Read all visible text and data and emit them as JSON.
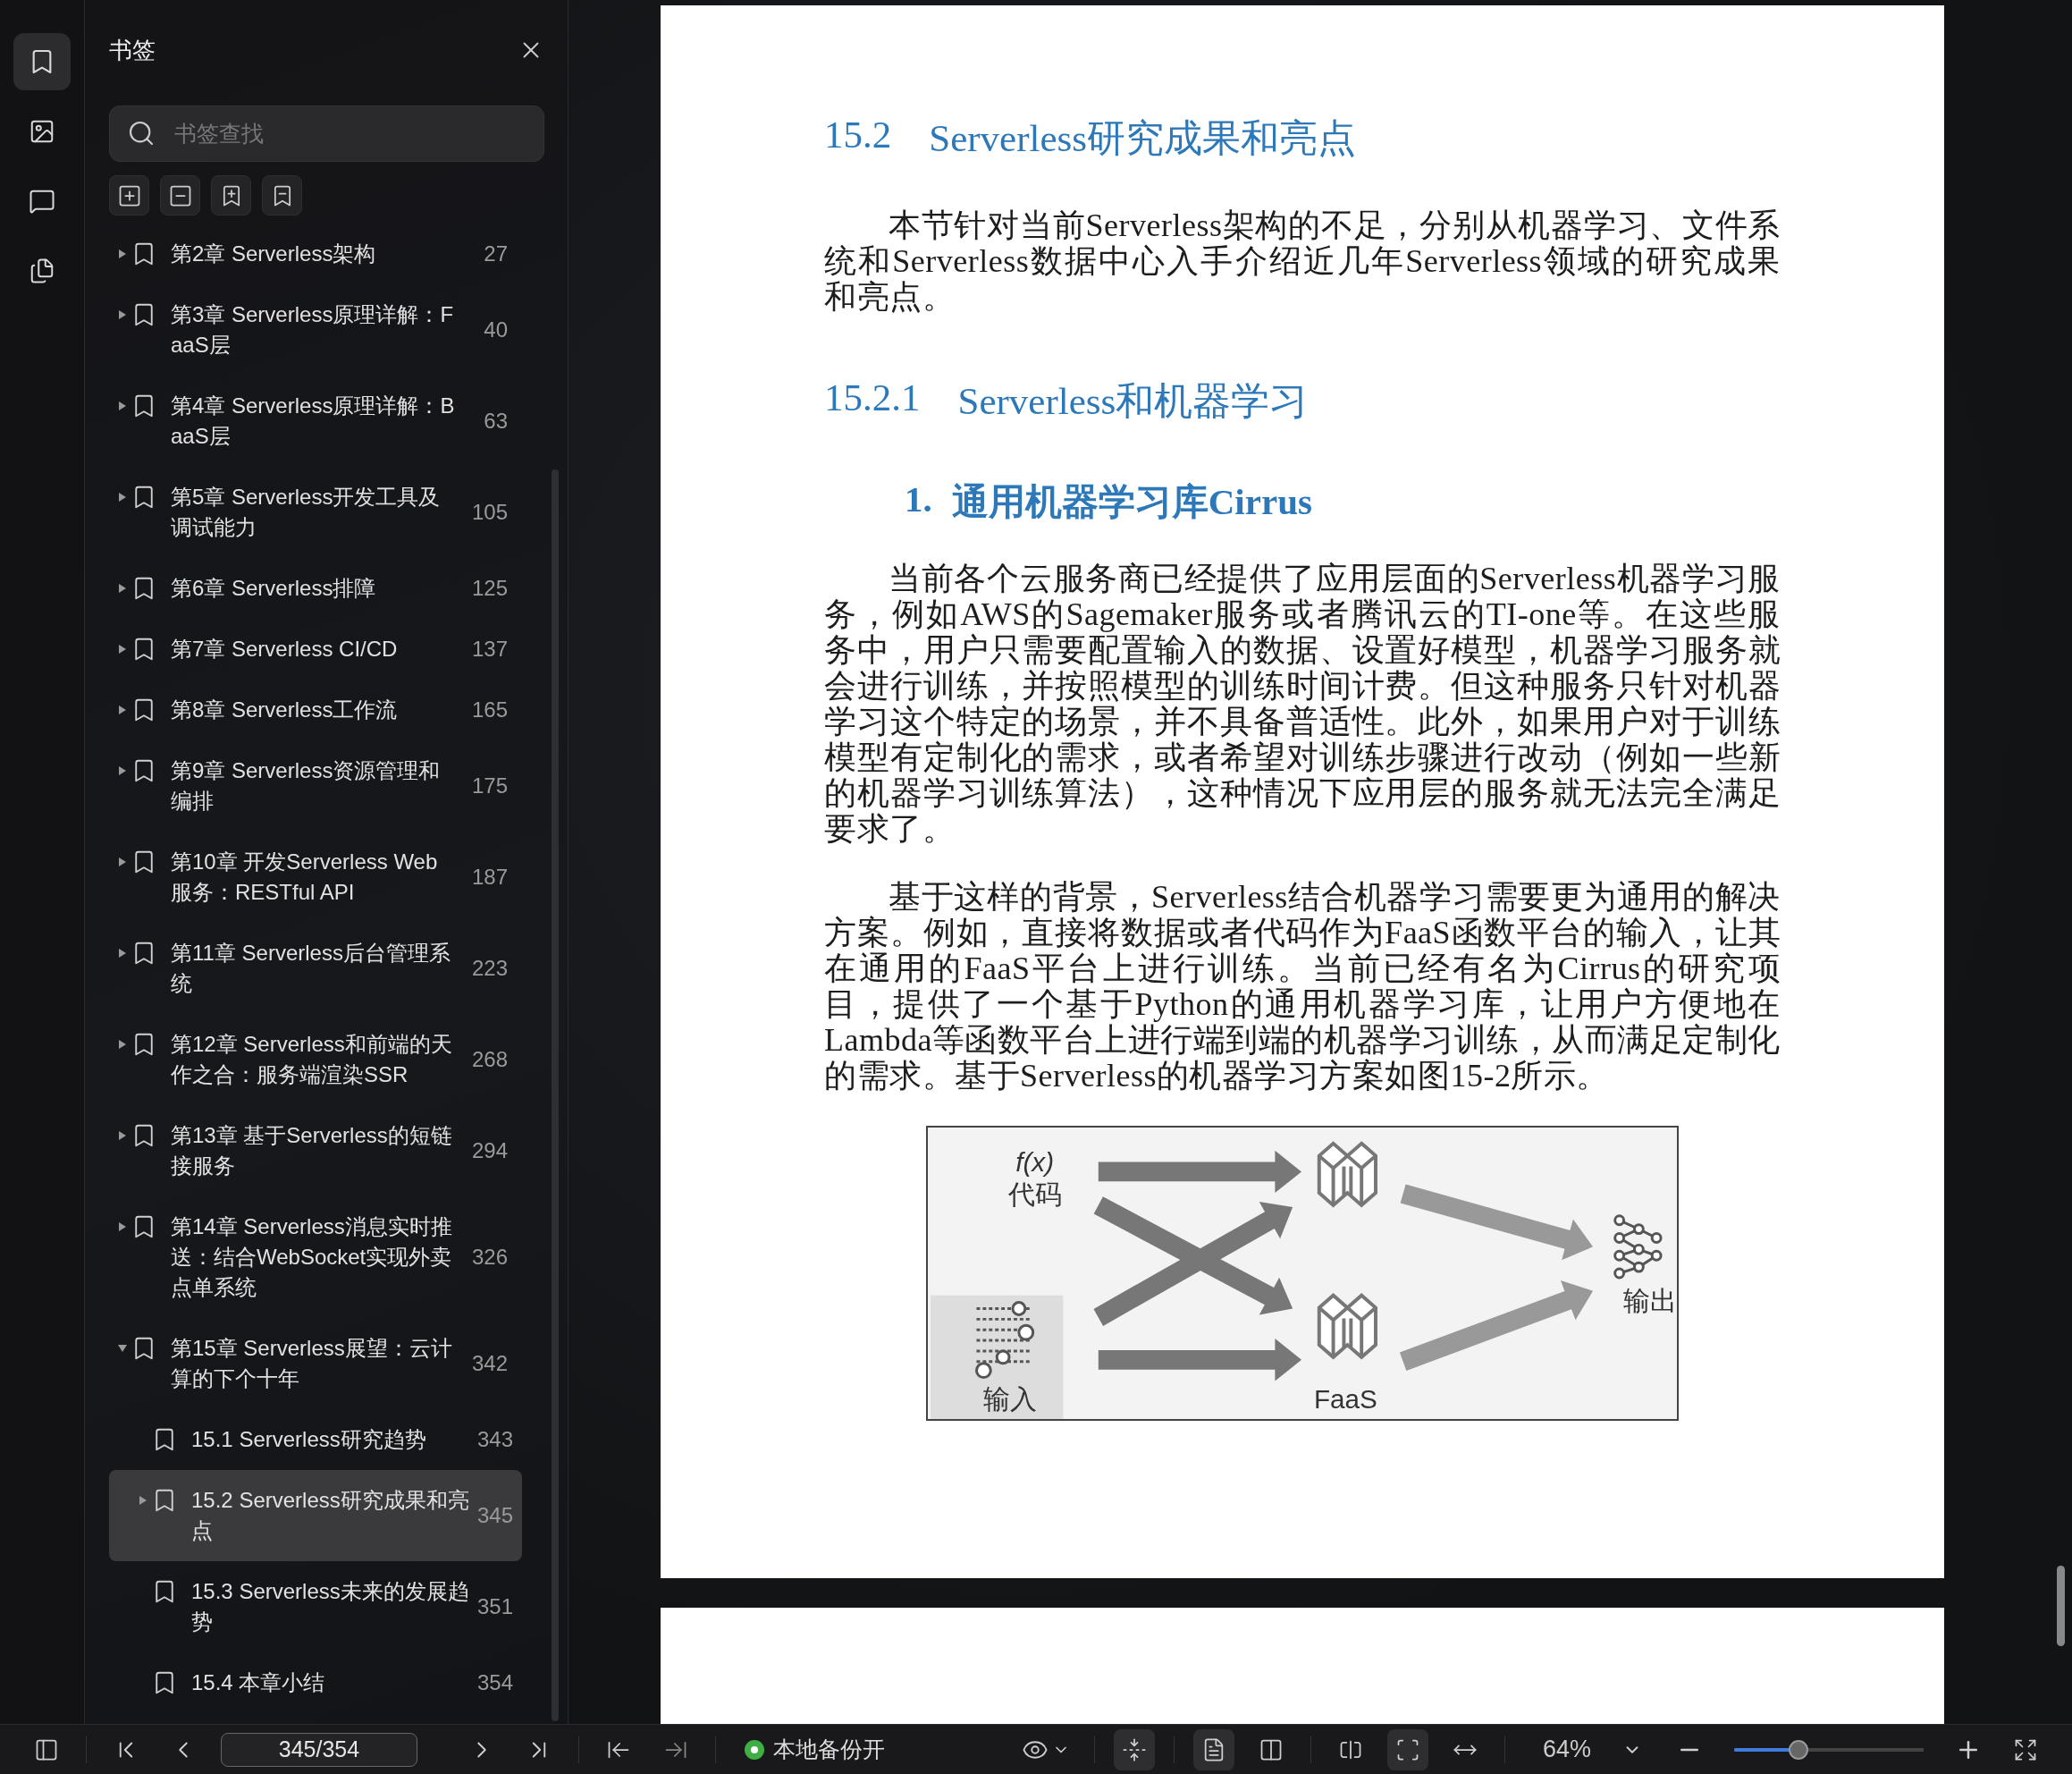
{
  "rail": [
    {
      "kind": "bookmark",
      "selected": true
    },
    {
      "kind": "image",
      "selected": false
    },
    {
      "kind": "comment",
      "selected": false
    },
    {
      "kind": "convert",
      "selected": false
    }
  ],
  "sidebar": {
    "title": "书签",
    "search": {
      "placeholder": "书签查找"
    },
    "tools": [
      {
        "kind": "expand"
      },
      {
        "kind": "collapse"
      },
      {
        "kind": "add"
      },
      {
        "kind": "remove"
      }
    ],
    "items": [
      {
        "title": "第2章 Serverless架构",
        "page": "27",
        "kind": "branch",
        "expanded": false,
        "selected": false
      },
      {
        "title": "第3章 Serverless原理详解：FaaS层",
        "page": "40",
        "kind": "branch",
        "expanded": false,
        "selected": false
      },
      {
        "title": "第4章 Serverless原理详解：BaaS层",
        "page": "63",
        "kind": "branch",
        "expanded": false,
        "selected": false
      },
      {
        "title": "第5章 Serverless开发工具及调试能力",
        "page": "105",
        "kind": "branch",
        "expanded": false,
        "selected": false
      },
      {
        "title": "第6章 Serverless排障",
        "page": "125",
        "kind": "branch",
        "expanded": false,
        "selected": false
      },
      {
        "title": "第7章 Serverless CI/CD",
        "page": "137",
        "kind": "branch",
        "expanded": false,
        "selected": false
      },
      {
        "title": "第8章 Serverless工作流",
        "page": "165",
        "kind": "branch",
        "expanded": false,
        "selected": false
      },
      {
        "title": "第9章 Serverless资源管理和编排",
        "page": "175",
        "kind": "branch",
        "expanded": false,
        "selected": false
      },
      {
        "title": "第10章 开发Serverless Web服务：RESTful API",
        "page": "187",
        "kind": "branch",
        "expanded": false,
        "selected": false
      },
      {
        "title": "第11章 Serverless后台管理系统",
        "page": "223",
        "kind": "branch",
        "expanded": false,
        "selected": false
      },
      {
        "title": "第12章 Serverless和前端的天作之合：服务端渲染SSR",
        "page": "268",
        "kind": "branch",
        "expanded": false,
        "selected": false
      },
      {
        "title": "第13章 基于Serverless的短链接服务",
        "page": "294",
        "kind": "branch",
        "expanded": false,
        "selected": false
      },
      {
        "title": "第14章 Serverless消息实时推送：结合WebSocket实现外卖点单系统",
        "page": "326",
        "kind": "branch",
        "expanded": false,
        "selected": false
      },
      {
        "title": "第15章 Serverless展望：云计算的下个十年",
        "page": "342",
        "kind": "branch",
        "expanded": true,
        "selected": false,
        "children": [
          {
            "title": "15.1 Serverless研究趋势",
            "page": "343",
            "kind": "leaf",
            "selected": false
          },
          {
            "title": "15.2 Serverless研究成果和亮点",
            "page": "345",
            "kind": "branch",
            "expanded": false,
            "selected": true
          },
          {
            "title": "15.3 Serverless未来的发展趋势",
            "page": "351",
            "kind": "leaf",
            "selected": false
          },
          {
            "title": "15.4 本章小结",
            "page": "354",
            "kind": "leaf",
            "selected": false
          }
        ]
      }
    ]
  },
  "document": {
    "blocks": [
      {
        "kind": "h2",
        "number": "15.2",
        "title": "Serverless研究成果和亮点"
      },
      {
        "kind": "para",
        "text": "本节针对当前Serverless架构的不足，分别从机器学习、文件系统和Serverless数据中心入手介绍近几年Serverless领域的研究成果和亮点。"
      },
      {
        "kind": "h3",
        "number": "15.2.1",
        "title": "Serverless和机器学习"
      },
      {
        "kind": "h4",
        "number": "1.",
        "title": "通用机器学习库Cirrus"
      },
      {
        "kind": "para",
        "text": "当前各个云服务商已经提供了应用层面的Serverless机器学习服务，例如AWS的Sagemaker服务或者腾讯云的TI-one等。在这些服务中，用户只需要配置输入的数据、设置好模型，机器学习服务就会进行训练，并按照模型的训练时间计费。但这种服务只针对机器学习这个特定的场景，并不具备普适性。此外，如果用户对于训练模型有定制化的需求，或者希望对训练步骤进行改动（例如一些新的机器学习训练算法），这种情况下应用层的服务就无法完全满足要求了。"
      },
      {
        "kind": "para",
        "text": "基于这样的背景，Serverless结合机器学习需要更为通用的解决方案。例如，直接将数据或者代码作为FaaS函数平台的输入，让其在通用的FaaS平台上进行训练。当前已经有名为Cirrus的研究项目，提供了一个基于Python的通用机器学习库，让用户方便地在Lambda等函数平台上进行端到端的机器学习训练，从而满足定制化的需求。基于Serverless的机器学习方案如图15-2所示。"
      },
      {
        "kind": "figure",
        "labels": [
          "f(x)",
          "代码",
          "输入",
          "FaaS",
          "输出"
        ]
      }
    ]
  },
  "bottom_bar": {
    "page_field": "345/354",
    "status": {
      "text": "本地备份开",
      "on": true
    },
    "view_buttons": [
      {
        "kind": "scroll",
        "selected": true
      },
      {
        "kind": "single",
        "selected": true
      },
      {
        "kind": "double",
        "selected": false
      },
      {
        "kind": "split",
        "selected": false
      },
      {
        "kind": "fit",
        "selected": true
      },
      {
        "kind": "width",
        "selected": false
      }
    ],
    "zoom": {
      "text": "64%",
      "level": 0.34
    }
  }
}
